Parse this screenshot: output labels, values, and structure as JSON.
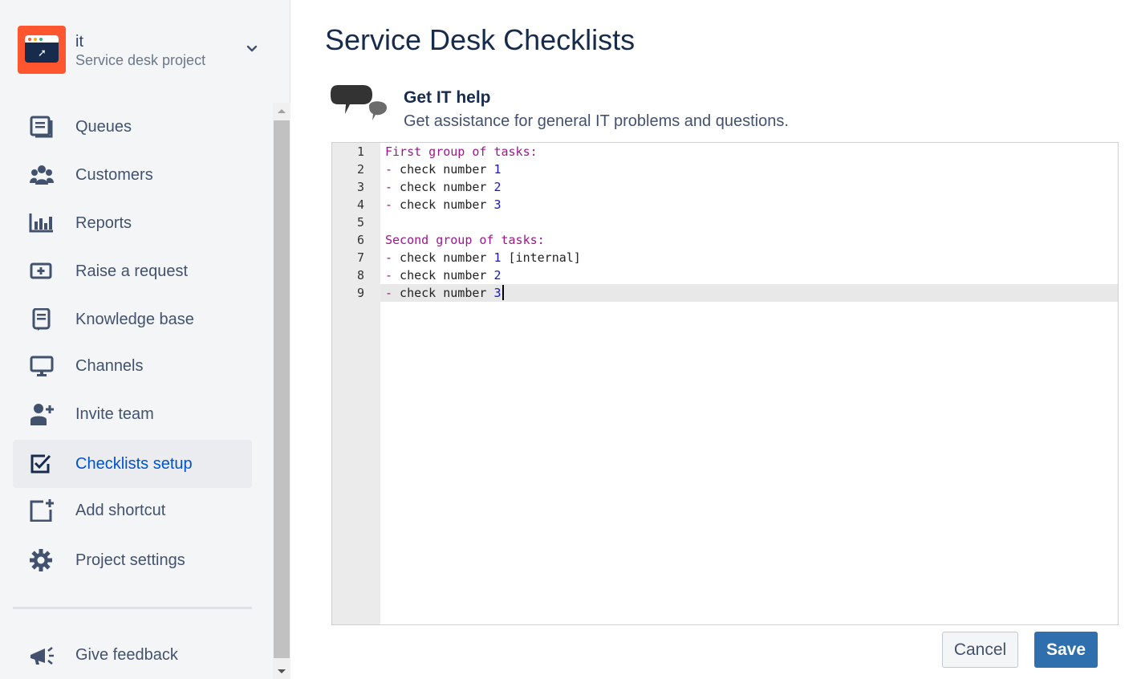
{
  "project": {
    "name": "it",
    "type": "Service desk project"
  },
  "nav": {
    "items": [
      {
        "label": "Queues",
        "icon": "queues-icon"
      },
      {
        "label": "Customers",
        "icon": "customers-icon"
      },
      {
        "label": "Reports",
        "icon": "reports-icon"
      },
      {
        "label": "Raise a request",
        "icon": "raise-request-icon"
      },
      {
        "label": "Knowledge base",
        "icon": "knowledge-base-icon"
      },
      {
        "label": "Channels",
        "icon": "channels-icon"
      },
      {
        "label": "Invite team",
        "icon": "invite-team-icon"
      },
      {
        "label": "Checklists setup",
        "icon": "checklist-icon",
        "active": true
      },
      {
        "label": "Add shortcut",
        "icon": "add-shortcut-icon"
      },
      {
        "label": "Project settings",
        "icon": "gear-icon"
      }
    ],
    "feedback": {
      "label": "Give feedback",
      "icon": "megaphone-icon"
    }
  },
  "page": {
    "title": "Service Desk Checklists"
  },
  "request_type": {
    "title": "Get IT help",
    "description": "Get assistance for general IT problems and questions.",
    "icon": "chat-bubbles-icon"
  },
  "editor": {
    "lines": [
      {
        "n": "1",
        "parts": [
          {
            "t": "First group of tasks:",
            "c": "hdr"
          }
        ]
      },
      {
        "n": "2",
        "parts": [
          {
            "t": "-",
            "c": "dash"
          },
          {
            "t": " check number ",
            "c": ""
          },
          {
            "t": "1",
            "c": "num"
          }
        ]
      },
      {
        "n": "3",
        "parts": [
          {
            "t": "-",
            "c": "dash"
          },
          {
            "t": " check number ",
            "c": ""
          },
          {
            "t": "2",
            "c": "num"
          }
        ]
      },
      {
        "n": "4",
        "parts": [
          {
            "t": "-",
            "c": "dash"
          },
          {
            "t": " check number ",
            "c": ""
          },
          {
            "t": "3",
            "c": "num"
          }
        ]
      },
      {
        "n": "5",
        "parts": []
      },
      {
        "n": "6",
        "parts": [
          {
            "t": "Second group of tasks:",
            "c": "hdr"
          }
        ]
      },
      {
        "n": "7",
        "parts": [
          {
            "t": "-",
            "c": "dash"
          },
          {
            "t": " check number ",
            "c": ""
          },
          {
            "t": "1",
            "c": "num"
          },
          {
            "t": " [internal]",
            "c": ""
          }
        ]
      },
      {
        "n": "8",
        "parts": [
          {
            "t": "-",
            "c": "dash"
          },
          {
            "t": " check number ",
            "c": ""
          },
          {
            "t": "2",
            "c": "num"
          }
        ]
      },
      {
        "n": "9",
        "parts": [
          {
            "t": "-",
            "c": "dash"
          },
          {
            "t": " check number ",
            "c": ""
          },
          {
            "t": "3",
            "c": "num"
          }
        ],
        "active": true
      }
    ]
  },
  "buttons": {
    "cancel": "Cancel",
    "save": "Save"
  },
  "colors": {
    "save_button": "#2f6fad",
    "active_nav_text": "#0052cc",
    "project_avatar": "#ff5630"
  }
}
